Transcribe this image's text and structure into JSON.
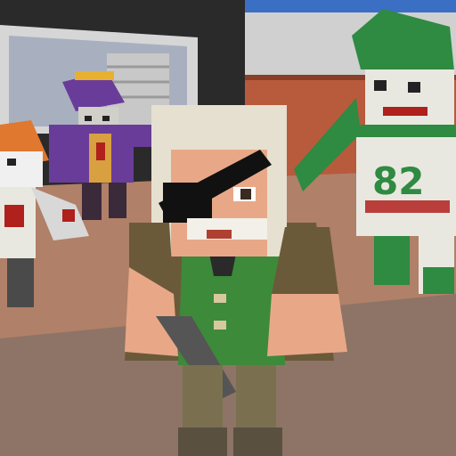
{
  "scene": {
    "description_free": true,
    "jersey": {
      "number_text": "82"
    }
  },
  "colors": {
    "sky": "#3a6fc4",
    "floor": "#b08068",
    "floor_far": "#c49a80",
    "wall_dark": "#2b2b2b",
    "wall_light": "#d8d8d8",
    "brick": "#b85a3c",
    "zombie_green": "#2f8a42",
    "zombie_white": "#e8e8e0",
    "purple": "#6a3c9a",
    "orange": "#e07830",
    "hero_shirt": "#3d8a3a",
    "hero_vest": "#6b5a3a",
    "skin": "#e8a888",
    "hair": "#e6e0d0",
    "eyepatch": "#111111",
    "blood": "#b0201c"
  }
}
